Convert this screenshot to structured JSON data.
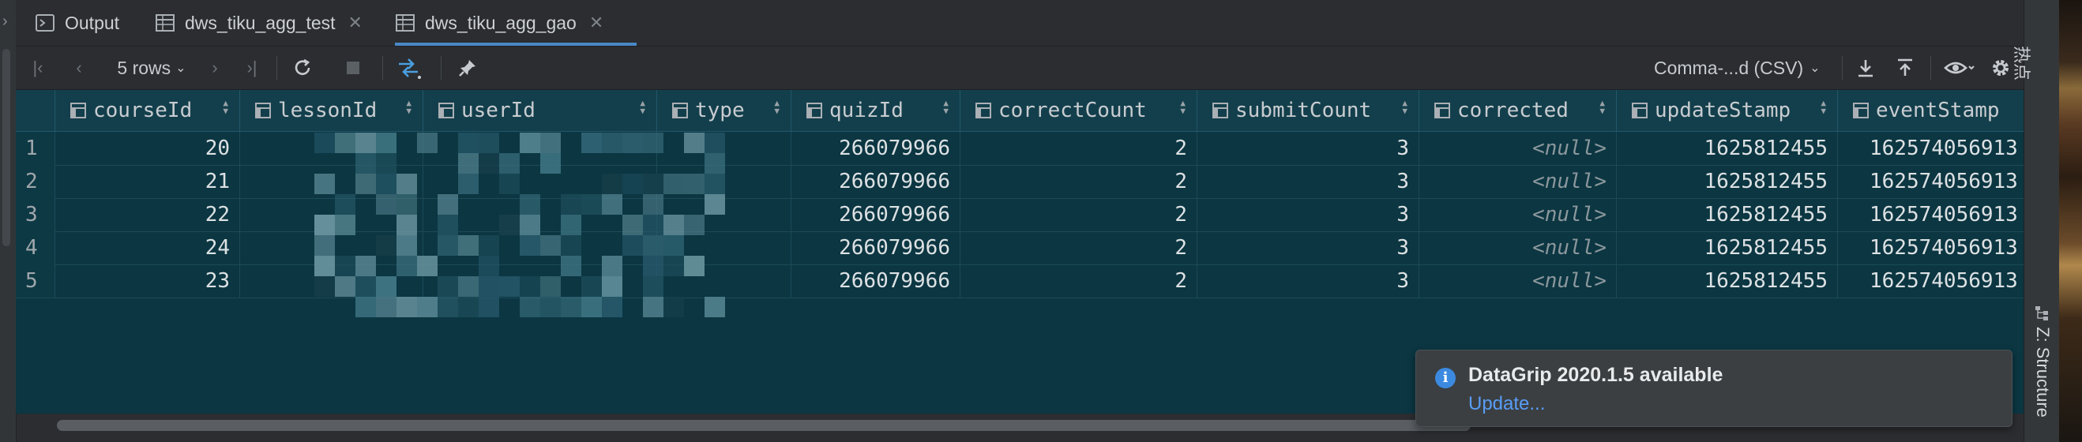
{
  "tabs": [
    {
      "label": "Output",
      "icon": "output-console-icon",
      "active": false,
      "closable": false
    },
    {
      "label": "dws_tiku_agg_test",
      "icon": "table-icon",
      "active": false,
      "closable": true
    },
    {
      "label": "dws_tiku_agg_gao",
      "icon": "table-icon",
      "active": true,
      "closable": true
    }
  ],
  "toolbar": {
    "rows_selector": "5 rows",
    "export_format": "Comma-...d (CSV)"
  },
  "columns": [
    "courseId",
    "lessonId",
    "userId",
    "type",
    "quizId",
    "correctCount",
    "submitCount",
    "corrected",
    "updateStamp",
    "eventStamp"
  ],
  "rows": [
    {
      "num": "1",
      "courseId": "20",
      "quizId": "266079966",
      "correctCount": "2",
      "submitCount": "3",
      "corrected": "<null>",
      "updateStamp": "1625812455",
      "eventStamp": "162574056913"
    },
    {
      "num": "2",
      "courseId": "21",
      "quizId": "266079966",
      "correctCount": "2",
      "submitCount": "3",
      "corrected": "<null>",
      "updateStamp": "1625812455",
      "eventStamp": "162574056913"
    },
    {
      "num": "3",
      "courseId": "22",
      "quizId": "266079966",
      "correctCount": "2",
      "submitCount": "3",
      "corrected": "<null>",
      "updateStamp": "1625812455",
      "eventStamp": "162574056913"
    },
    {
      "num": "4",
      "courseId": "24",
      "quizId": "266079966",
      "correctCount": "2",
      "submitCount": "3",
      "corrected": "<null>",
      "updateStamp": "1625812455",
      "eventStamp": "162574056913"
    },
    {
      "num": "5",
      "courseId": "23",
      "quizId": "266079966",
      "correctCount": "2",
      "submitCount": "3",
      "corrected": "<null>",
      "updateStamp": "1625812455",
      "eventStamp": "162574056913"
    }
  ],
  "notification": {
    "title": "DataGrip 2020.1.5 available",
    "link": "Update..."
  },
  "side_tabs": {
    "structure": "Z: Structure",
    "top": "热点"
  },
  "colors": {
    "grid_background": "#0b3642",
    "header_background": "#133f4c",
    "accent": "#4a88c7",
    "link": "#589df6"
  }
}
